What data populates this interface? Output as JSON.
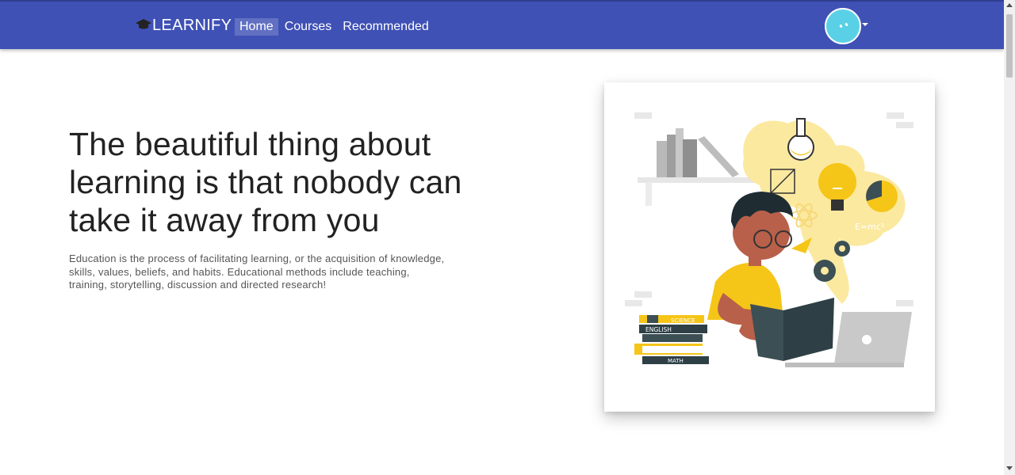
{
  "navbar": {
    "brand": "LEARNIFY",
    "links": [
      {
        "label": "Home",
        "active": true
      },
      {
        "label": "Courses",
        "active": false
      },
      {
        "label": "Recommended",
        "active": false
      }
    ],
    "color": "#3f51b5"
  },
  "hero": {
    "title": "The beautiful thing about learning is that nobody can take it away from you",
    "text": "Education is the process of facilitating learning, or the acquisition of knowledge, skills, values, beliefs, and habits. Educational methods include teaching, training, storytelling, discussion and directed research!"
  },
  "illustration": {
    "books": [
      "SCIENCE",
      "ENGLISH",
      "MATH"
    ],
    "formula": "E=mc²",
    "accent": "#f5c518"
  }
}
